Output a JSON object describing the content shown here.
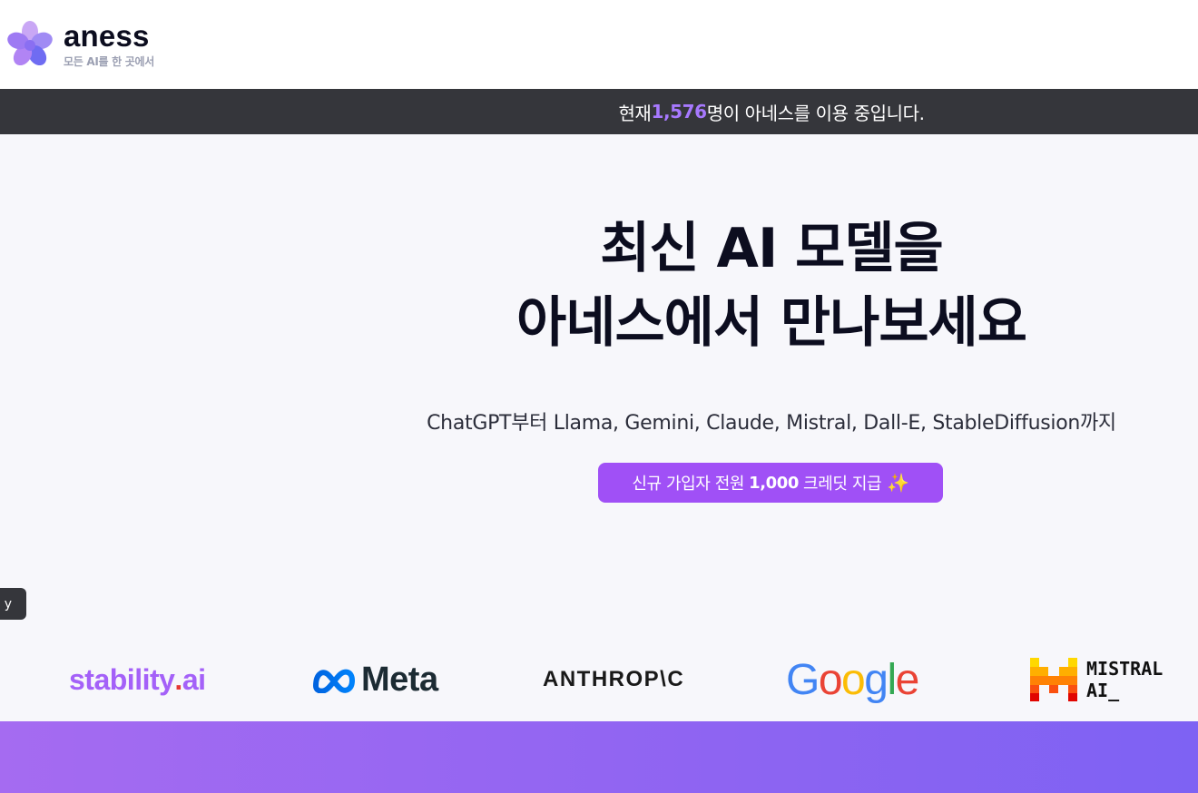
{
  "header": {
    "brand": "aness",
    "tagline": "모든 AI를 한 곳에서"
  },
  "banner": {
    "prefix": "현재 ",
    "count": "1,576",
    "suffix": "명이 아네스를 이용 중입니다."
  },
  "hero": {
    "title_line1": "최신 AI 모델을",
    "title_line2": "아네스에서 만나보세요",
    "subtitle": "ChatGPT부터 Llama, Gemini, Claude, Mistral, Dall-E, StableDiffusion까지",
    "cta_prefix": "신규 가입자 전원",
    "cta_credit": "1,000",
    "cta_suffix": "크레딧 지급",
    "cta_icon": "sparkles-icon",
    "side_tab_label": "y"
  },
  "partners": {
    "stability_main": "stability",
    "stability_dot": ".",
    "stability_tail": "ai",
    "meta": "Meta",
    "anthropic": "ANTHROP\\C",
    "google": [
      "G",
      "o",
      "o",
      "g",
      "l",
      "e"
    ],
    "mistral_line1": "MISTRAL",
    "mistral_line2": "AI_"
  },
  "colors": {
    "accent": "#a050f6",
    "banner_bg": "#35363b",
    "count": "#a779ff",
    "hero_bg": "#f7f7fb",
    "gradient_start": "#a56bf1",
    "gradient_end": "#7e62f3"
  }
}
